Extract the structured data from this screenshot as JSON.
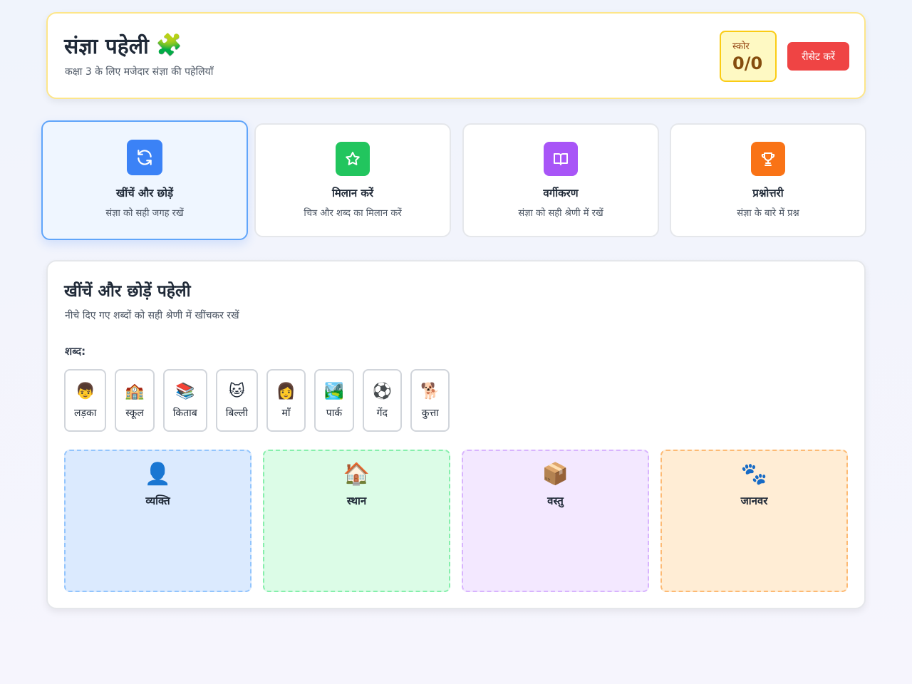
{
  "header": {
    "title": "संज्ञा पहेली",
    "title_icon": "🧩",
    "subtitle": "कक्षा 3 के लिए मजेदार संज्ञा की पहेलियाँ",
    "score_label": "स्कोर",
    "score_value": "0/0",
    "reset_label": "रीसेट करें"
  },
  "modes": [
    {
      "title": "खींचें और छोड़ें",
      "desc": "संज्ञा को सही जगह रखें",
      "icon": "refresh-icon",
      "color": "#3b82f6",
      "active": true
    },
    {
      "title": "मिलान करें",
      "desc": "चित्र और शब्द का मिलान करें",
      "icon": "star-icon",
      "color": "#22c55e",
      "active": false
    },
    {
      "title": "वर्गीकरण",
      "desc": "संज्ञा को सही श्रेणी में रखें",
      "icon": "book-icon",
      "color": "#a855f7",
      "active": false
    },
    {
      "title": "प्रश्नोत्तरी",
      "desc": "संज्ञा के बारे में प्रश्न",
      "icon": "trophy-icon",
      "color": "#f97316",
      "active": false
    }
  ],
  "game": {
    "title": "खींचें और छोड़ें पहेली",
    "subtitle": "नीचे दिए गए शब्दों को सही श्रेणी में खींचकर रखें",
    "words_label": "शब्द:",
    "words": [
      {
        "emoji": "👦",
        "text": "लड़का"
      },
      {
        "emoji": "🏫",
        "text": "स्कूल"
      },
      {
        "emoji": "📚",
        "text": "किताब"
      },
      {
        "emoji": "🐱",
        "text": "बिल्ली"
      },
      {
        "emoji": "👩",
        "text": "माँ"
      },
      {
        "emoji": "🏞️",
        "text": "पार्क"
      },
      {
        "emoji": "⚽",
        "text": "गेंद"
      },
      {
        "emoji": "🐕",
        "text": "कुत्ता"
      }
    ],
    "zones": [
      {
        "emoji": "👤",
        "title": "व्यक्ति",
        "bg": "#dbeafe",
        "border": "#93c5fd"
      },
      {
        "emoji": "🏠",
        "title": "स्थान",
        "bg": "#dcfce7",
        "border": "#86efac"
      },
      {
        "emoji": "📦",
        "title": "वस्तु",
        "bg": "#f3e8ff",
        "border": "#d8b4fe"
      },
      {
        "emoji": "🐾",
        "title": "जानवर",
        "bg": "#ffedd5",
        "border": "#fdba74"
      }
    ]
  }
}
